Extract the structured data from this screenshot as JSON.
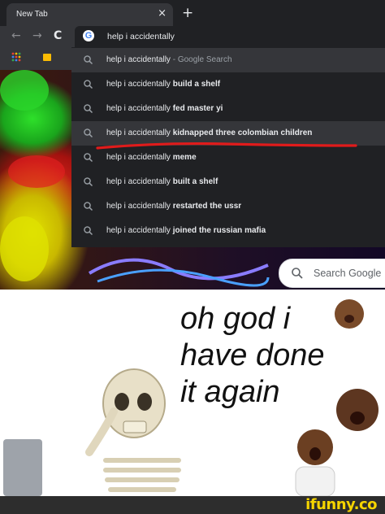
{
  "browser": {
    "tab_title": "New Tab",
    "tab_close": "×",
    "new_tab": "+",
    "nav": {
      "back": "←",
      "forward": "→",
      "reload": "C"
    },
    "omnibox_value": "help i accidentally"
  },
  "suggestions": [
    {
      "prefix": "help i accidentally",
      "bold": "",
      "suffix": " - Google Search",
      "highlight": true
    },
    {
      "prefix": "help i accidentally ",
      "bold": "build a shelf",
      "suffix": "",
      "highlight": false
    },
    {
      "prefix": "help i accidentally ",
      "bold": "fed master yi",
      "suffix": "",
      "highlight": false
    },
    {
      "prefix": "help i accidentally ",
      "bold": "kidnapped three colombian children",
      "suffix": "",
      "highlight": true
    },
    {
      "prefix": "help i accidentally ",
      "bold": "meme",
      "suffix": "",
      "highlight": false
    },
    {
      "prefix": "help i accidentally ",
      "bold": "built a shelf",
      "suffix": "",
      "highlight": false
    },
    {
      "prefix": "help i accidentally ",
      "bold": "restarted the ussr",
      "suffix": "",
      "highlight": false
    },
    {
      "prefix": "help i accidentally ",
      "bold": "joined the russian mafia",
      "suffix": "",
      "highlight": false
    }
  ],
  "search_pill": {
    "label": "Search Google"
  },
  "meme": {
    "caption_lines": [
      "oh god i",
      "have done",
      "it again"
    ]
  },
  "watermark": "ifunny.co",
  "colors": {
    "chrome_dark": "#202124",
    "chrome_mid": "#35363a",
    "text_light": "#e8eaed",
    "annotation_red": "#e01b1b",
    "watermark_yellow": "#f5d400"
  }
}
